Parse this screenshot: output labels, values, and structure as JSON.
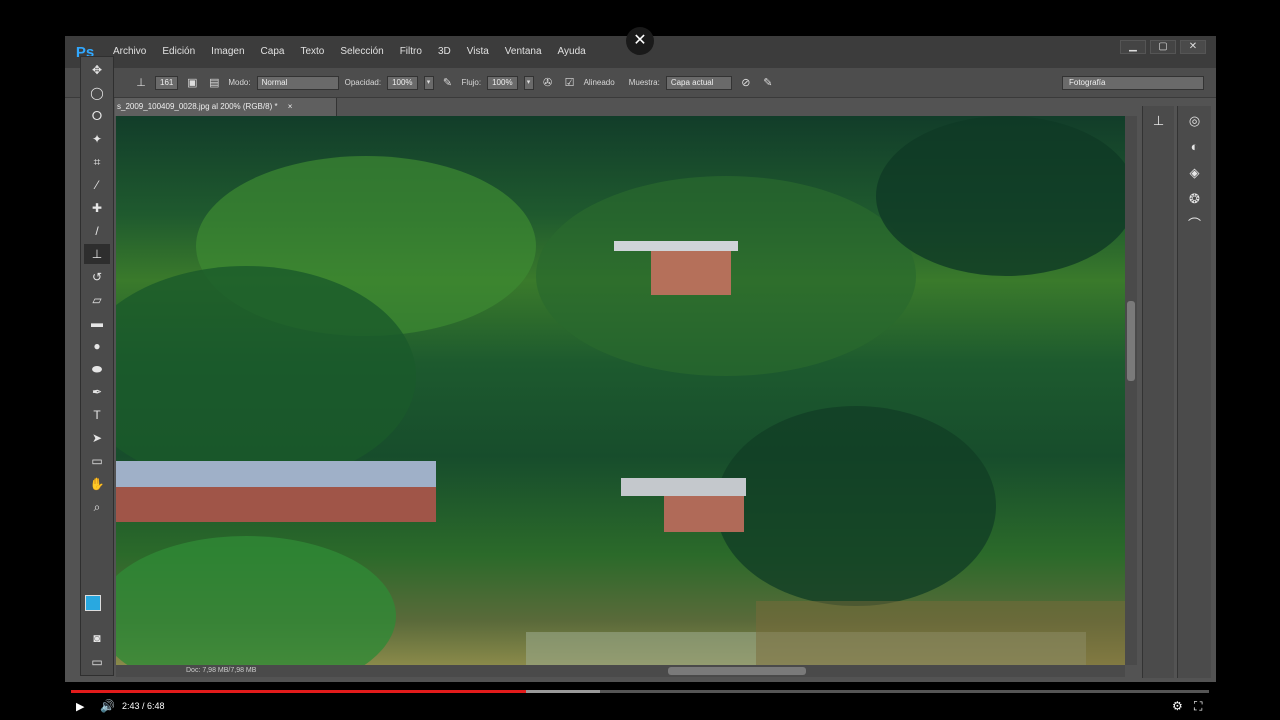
{
  "app": {
    "logo": "Ps"
  },
  "menu": [
    "Archivo",
    "Edición",
    "Imagen",
    "Capa",
    "Texto",
    "Selección",
    "Filtro",
    "3D",
    "Vista",
    "Ventana",
    "Ayuda"
  ],
  "window_controls": {
    "minimize": "▁",
    "maximize": "▢",
    "close": "✕"
  },
  "options": {
    "brush_size": "161",
    "mode_label": "Modo:",
    "mode_value": "Normal",
    "opacity_label": "Opacidad:",
    "opacity_value": "100%",
    "flow_label": "Flujo:",
    "flow_value": "100%",
    "aligned_label": "Alineado",
    "sample_label": "Muestra:",
    "sample_value": "Capa actual",
    "workspace": "Fotografía"
  },
  "document": {
    "tab_title": "s_2009_100409_0028.jpg al 200% (RGB/8) *",
    "tab_close": "×",
    "status": "Doc: 7,98 MB/7,98 MB"
  },
  "colors": {
    "foreground": "#29a8e0",
    "background": "#000000"
  },
  "video": {
    "time": "2:43 / 6:48",
    "played_fraction": 0.4,
    "loaded_fraction": 0.465,
    "close": "✕"
  }
}
